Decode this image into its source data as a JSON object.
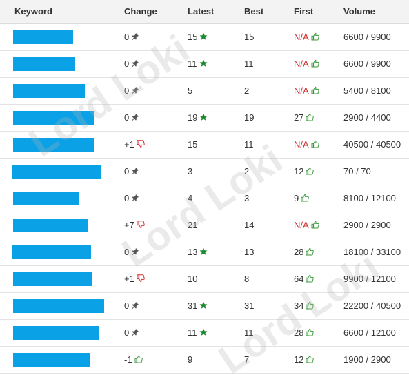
{
  "headers": {
    "keyword": "Keyword",
    "change": "Change",
    "latest": "Latest",
    "best": "Best",
    "first": "First",
    "volume": "Volume"
  },
  "watermark": "Lord Loki",
  "colors": {
    "redaction": "#0aa1e6",
    "star": "#1b8a2e",
    "thumb_up": "#3c9a3c",
    "thumb_down": "#d32f2f",
    "pin": "#555555",
    "na_text": "#d32f2f"
  },
  "rows": [
    {
      "change": "0",
      "change_icon": "pin-icon",
      "latest": "15",
      "latest_icon": "star-icon",
      "best": "15",
      "first": "N/A",
      "first_na": true,
      "volume": "6600 / 9900"
    },
    {
      "change": "0",
      "change_icon": "pin-icon",
      "latest": "11",
      "latest_icon": "star-icon",
      "best": "11",
      "first": "N/A",
      "first_na": true,
      "volume": "6600 / 9900"
    },
    {
      "change": "0",
      "change_icon": "pin-icon",
      "latest": "5",
      "latest_icon": "",
      "best": "2",
      "first": "N/A",
      "first_na": true,
      "volume": "5400 / 8100"
    },
    {
      "change": "0",
      "change_icon": "pin-icon",
      "latest": "19",
      "latest_icon": "star-icon",
      "best": "19",
      "first": "27",
      "first_na": false,
      "volume": "2900 / 4400"
    },
    {
      "change": "+1",
      "change_icon": "thumb-down-icon",
      "latest": "15",
      "latest_icon": "",
      "best": "11",
      "first": "N/A",
      "first_na": true,
      "volume": "40500 / 40500"
    },
    {
      "change": "0",
      "change_icon": "pin-icon",
      "latest": "3",
      "latest_icon": "",
      "best": "2",
      "first": "12",
      "first_na": false,
      "volume": "70 / 70"
    },
    {
      "change": "0",
      "change_icon": "pin-icon",
      "latest": "4",
      "latest_icon": "",
      "best": "3",
      "first": "9",
      "first_na": false,
      "volume": "8100 / 12100"
    },
    {
      "change": "+7",
      "change_icon": "thumb-down-icon",
      "latest": "21",
      "latest_icon": "",
      "best": "14",
      "first": "N/A",
      "first_na": true,
      "volume": "2900 / 2900"
    },
    {
      "change": "0",
      "change_icon": "pin-icon",
      "latest": "13",
      "latest_icon": "star-icon",
      "best": "13",
      "first": "28",
      "first_na": false,
      "volume": "18100 / 33100"
    },
    {
      "change": "+1",
      "change_icon": "thumb-down-icon",
      "latest": "10",
      "latest_icon": "",
      "best": "8",
      "first": "64",
      "first_na": false,
      "volume": "9900 / 12100"
    },
    {
      "change": "0",
      "change_icon": "pin-icon",
      "latest": "31",
      "latest_icon": "star-icon",
      "best": "31",
      "first": "34",
      "first_na": false,
      "volume": "22200 / 40500"
    },
    {
      "change": "0",
      "change_icon": "pin-icon",
      "latest": "11",
      "latest_icon": "star-icon",
      "best": "11",
      "first": "28",
      "first_na": false,
      "volume": "6600 / 12100"
    },
    {
      "change": "-1",
      "change_icon": "thumb-up-icon",
      "latest": "9",
      "latest_icon": "",
      "best": "7",
      "first": "12",
      "first_na": false,
      "volume": "1900 / 2900"
    }
  ]
}
